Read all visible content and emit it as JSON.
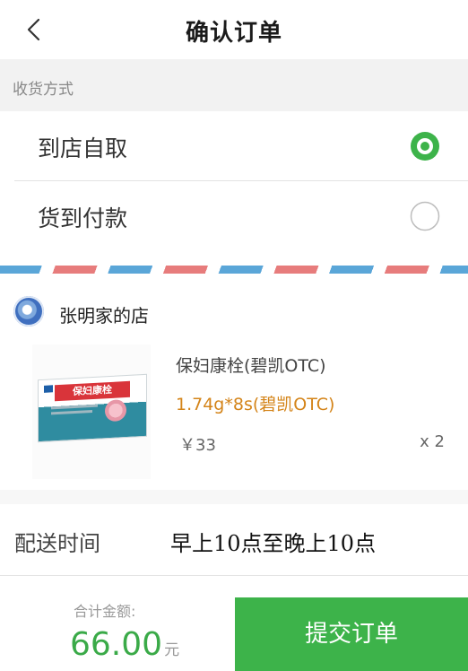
{
  "header": {
    "title": "确认订单"
  },
  "receipt": {
    "section_label": "收货方式",
    "options": [
      {
        "label": "到店自取",
        "selected": true
      },
      {
        "label": "货到付款",
        "selected": false
      }
    ]
  },
  "store": {
    "name": "张明家的店"
  },
  "product": {
    "name": "保妇康栓(碧凯OTC)",
    "spec": "1.74g*8s(碧凯OTC)",
    "price": "￥33",
    "quantity": "x 2",
    "box_label": "保妇康栓"
  },
  "delivery": {
    "label": "配送时间",
    "value": "早上10点至晚上10点"
  },
  "footer": {
    "total_label": "合计金额:",
    "total_amount": "66.00",
    "currency_unit": "元",
    "submit_label": "提交订单"
  },
  "colors": {
    "accent_green": "#3db34a",
    "spec_orange": "#d48419",
    "stripe_blue": "#5aa6d8",
    "stripe_red": "#e77c7c"
  }
}
